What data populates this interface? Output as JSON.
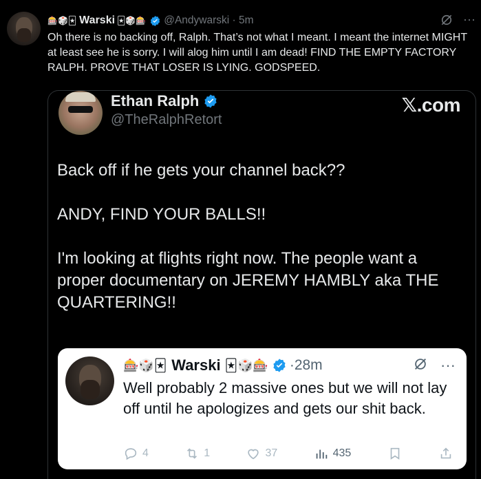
{
  "tweet": {
    "emoji_left": "🎰🎲🃏",
    "display_name": "Warski",
    "emoji_right": "🃏🎲🎰",
    "handle_time": "@Andywarski · 5m",
    "text": "Oh there is no backing off, Ralph. That’s not what I meant. I meant the internet MIGHT at least see he is sorry. I will alog him until I am dead! FIND THE EMPTY FACTORY RALPH. PROVE THAT LOSER IS LYING. GODSPEED.",
    "icons": [
      "grok-icon",
      "more-icon"
    ],
    "more_label": "···"
  },
  "quote": {
    "display_name": "Ethan Ralph",
    "handle": "@TheRalphRetort",
    "brand": "𝕏.com",
    "text": "Back off if he gets your channel back??\n\nANDY, FIND YOUR BALLS!!\n\nI'm looking at flights right now. The people want a proper documentary on JEREMY HAMBLY aka THE QUARTERING!!"
  },
  "inner": {
    "emoji_left": "🎰🎲🃏",
    "display_name": "Warski",
    "emoji_right": "🃏🎲🎰",
    "time": "·28m",
    "more_label": "···",
    "text": "Well probably 2 massive ones but we will not lay off until he apologizes and gets our shit back.",
    "replies": "4",
    "reposts": "1",
    "likes": "37",
    "views": "435"
  },
  "colors": {
    "verified": "#1d9bf0",
    "muted": "#71767b"
  }
}
